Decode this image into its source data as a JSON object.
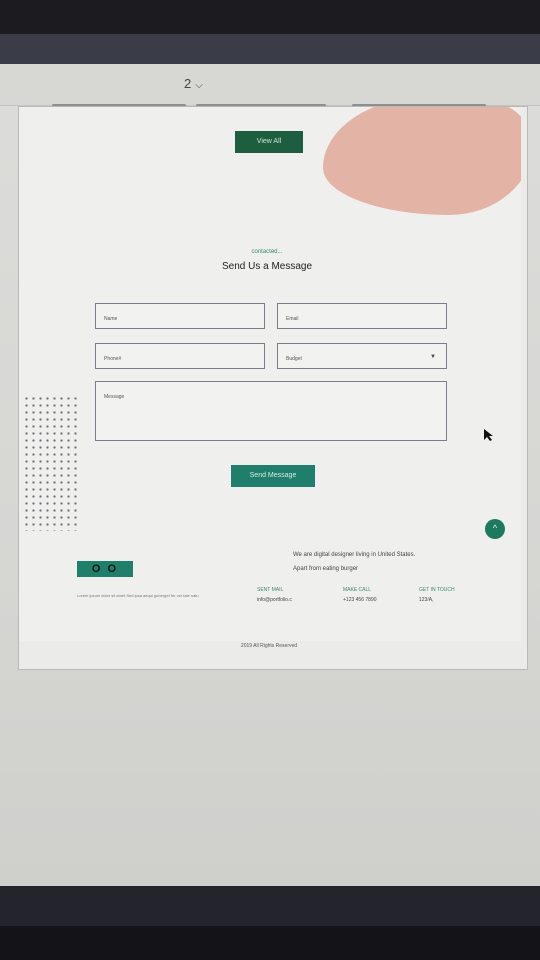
{
  "viewer": {
    "page_number": "2"
  },
  "icons": {
    "chevron": "chevron-down-icon",
    "select_caret": "caret-down-icon",
    "scroll_up": "arrow-up-icon",
    "cursor": "mouse-pointer-icon"
  },
  "colors": {
    "accent": "#1f7f6a",
    "accent_dark": "#1c5e3f",
    "blob": "#e3b4a6",
    "label": "#3a8a6a"
  },
  "buttons": {
    "view_all": "View All",
    "send_message": "Send Message"
  },
  "contact": {
    "subtitle": "contacted...",
    "title": "Send Us a Message",
    "placeholders": {
      "name": "Name",
      "email": "Email",
      "phone": "Phone#",
      "budget": "Budget",
      "message": "Message"
    }
  },
  "about": {
    "line1": "We are digital designer living in United States.",
    "line2": "Apart from eating burger"
  },
  "footer": {
    "logo": "O O",
    "lorem": "Lorem ipsum dolor sit amet Sed ipsa aequi guberget fer ver tale natu",
    "columns": [
      {
        "label": "SENT MAIL",
        "value": "info@portfolio.c"
      },
      {
        "label": "MAKE CALL",
        "value": "+123 456 7890"
      },
      {
        "label": "GET IN TOUCH",
        "value": "123/A,"
      }
    ],
    "copyright": "2019 All Rights Reserved"
  }
}
